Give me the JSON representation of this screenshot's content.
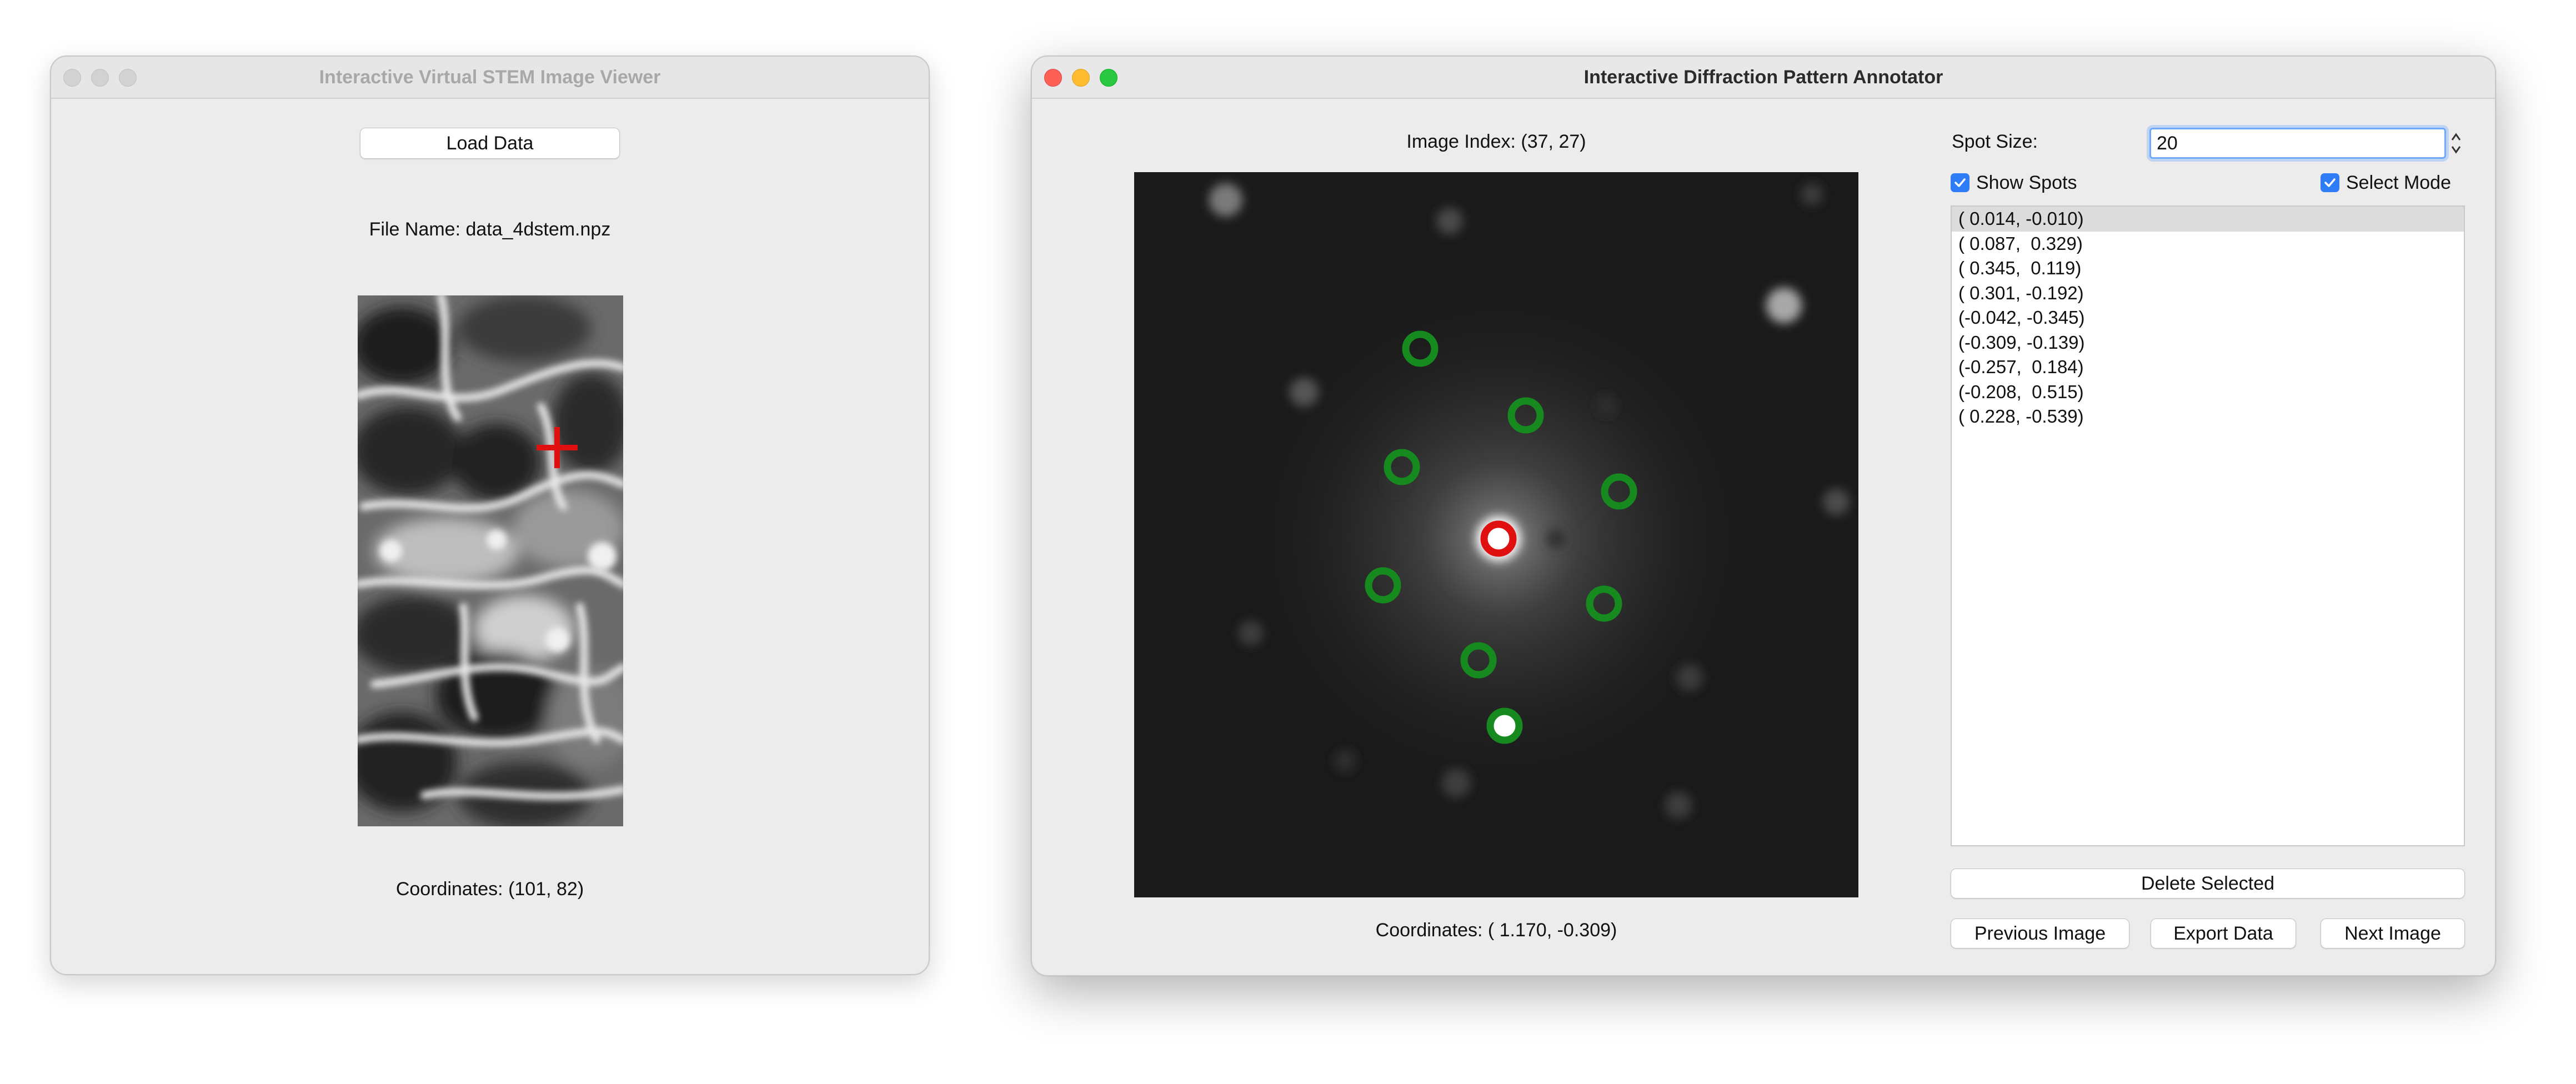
{
  "left_window": {
    "title": "Interactive Virtual STEM Image Viewer",
    "load_button": "Load Data",
    "file_name_label": "File Name: data_4dstem.npz",
    "coordinates_label": "Coordinates: (101, 82)"
  },
  "right_window": {
    "title": "Interactive Diffraction Pattern Annotator",
    "image_index_label": "Image Index: (37, 27)",
    "coordinates_label": "Coordinates: ( 1.170, -0.309)",
    "spot_size_label": "Spot Size:",
    "spot_size_value": "20",
    "show_spots_label": "Show Spots",
    "show_spots_checked": true,
    "select_mode_label": "Select Mode",
    "select_mode_checked": true,
    "spots": [
      "( 0.014, -0.010)",
      "( 0.087,  0.329)",
      "( 0.345,  0.119)",
      "( 0.301, -0.192)",
      "(-0.042, -0.345)",
      "(-0.309, -0.139)",
      "(-0.257,  0.184)",
      "(-0.208,  0.515)",
      "( 0.228, -0.539)"
    ],
    "selected_spot_index": 0,
    "delete_button": "Delete Selected",
    "prev_button": "Previous Image",
    "export_button": "Export Data",
    "next_button": "Next Image"
  },
  "colors": {
    "accent": "#2f7df6",
    "marker_red": "#e01010",
    "spot_green": "#1a8a1a"
  }
}
